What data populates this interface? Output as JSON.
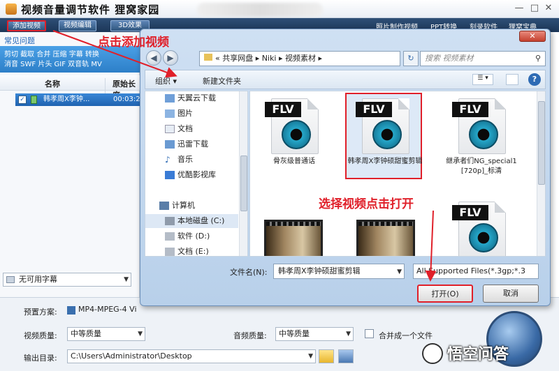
{
  "app": {
    "title": "视频音量调节软件   狸窝家园",
    "toolbar": [
      "添加视频",
      "视频编辑",
      "3D效果"
    ],
    "top_links": [
      "照片制作视频",
      "PPT转换",
      "刻录软件",
      "狸窝宝典"
    ],
    "window_controls": [
      "minimize-icon",
      "maximize-icon",
      "close-icon"
    ]
  },
  "left_pane": {
    "faq": "常见问题",
    "tools_row1": "剪切 截取 合并 压缩 字幕 转换",
    "tools_row2": "消音 SWF 片头 GIF 双音轨 MV",
    "col_name": "名称",
    "col_duration": "原始长度",
    "rows": [
      {
        "name": "韩孝周X李钟...",
        "duration": "00:03:2"
      }
    ],
    "subtitle": "无可用字幕"
  },
  "bottom": {
    "preset_label": "预置方案:",
    "preset_value": "MP4-MPEG-4 Vi",
    "video_quality_label": "视频质量:",
    "video_quality_value": "中等质量",
    "audio_quality_label": "音频质量:",
    "audio_quality_value": "中等质量",
    "merge_label": "合并成一个文件",
    "output_label": "输出目录:",
    "output_value": "C:\\Users\\Administrator\\Desktop"
  },
  "dialog": {
    "address_parts": [
      "共享网盘",
      "Niki",
      "视频素材"
    ],
    "search_placeholder": "搜索 视频素材",
    "organize": "组织 ▾",
    "new_folder": "新建文件夹",
    "nav_items": [
      "天翼云下载",
      "图片",
      "文档",
      "迅雷下载",
      "音乐",
      "优酷影视库",
      "计算机",
      "本地磁盘 (C:)",
      "软件 (D:)",
      "文档 (E:)"
    ],
    "files": [
      {
        "name": "骨灰级普通话",
        "type": "FLV"
      },
      {
        "name": "韩孝周X李钟硕甜蜜剪辑",
        "type": "FLV"
      },
      {
        "name": "继承者们NG_special1[720p]_标清",
        "type": "FLV"
      },
      {
        "name": "",
        "type": "FLV"
      }
    ],
    "filename_label": "文件名(N):",
    "filename_value": "韩孝周X李钟硕甜蜜剪辑",
    "filetype_value": "All Supported Files(*.3gp;*.3",
    "open_button": "打开(O)",
    "cancel_button": "取消"
  },
  "annotations": {
    "click_add": "点击添加视频",
    "select_open": "选择视频点击打开"
  },
  "watermark": "悟空问答"
}
